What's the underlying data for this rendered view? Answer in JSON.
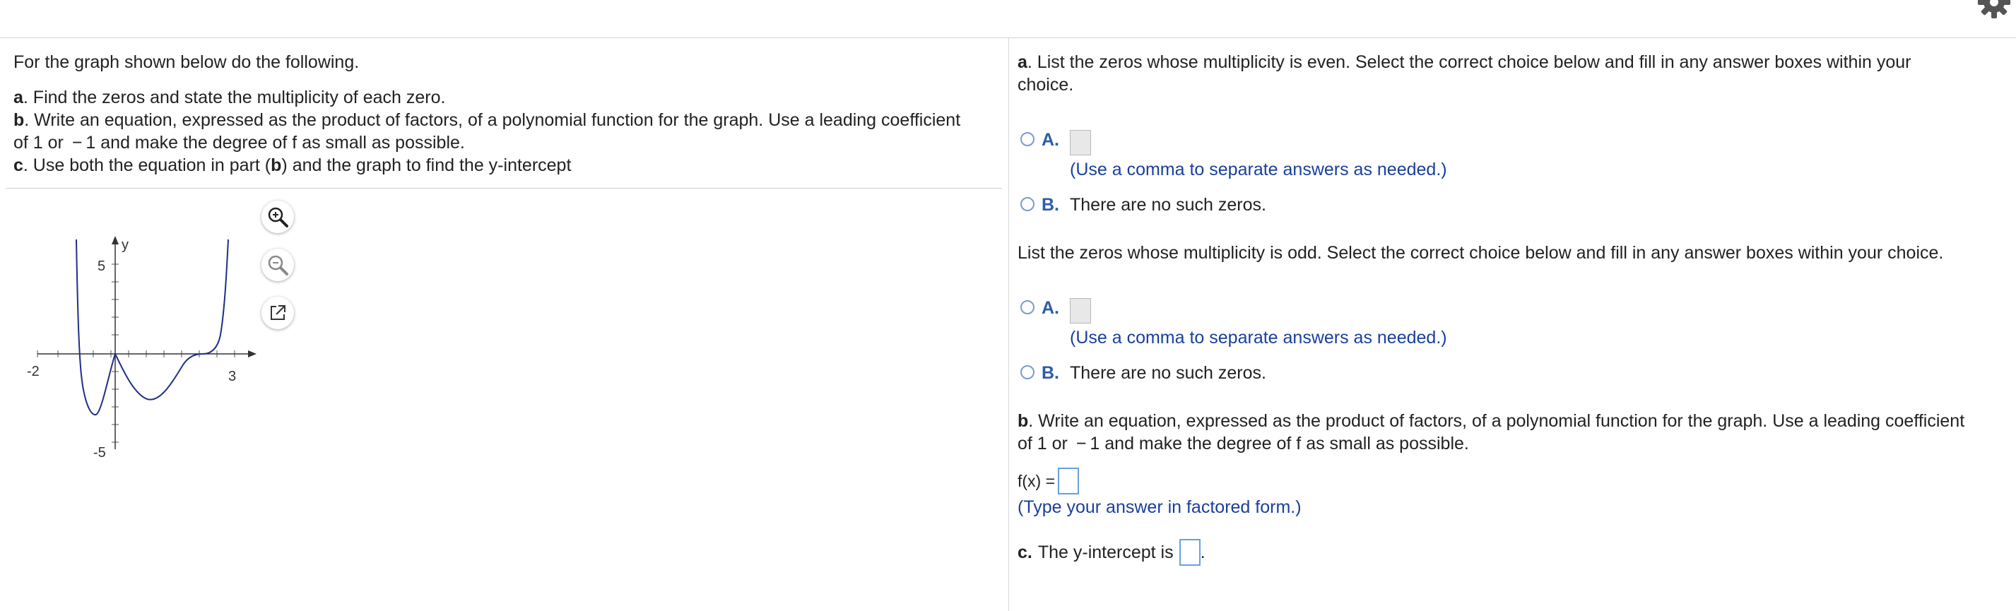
{
  "header": {
    "settings_icon": "gear-icon"
  },
  "left": {
    "intro": "For the graph shown below do the following.",
    "task_a_letter": "a",
    "task_a_text": ". Find the zeros and state the multiplicity of each zero.",
    "task_b_letter": "b",
    "task_b_text_line1": ". Write an equation, expressed as the product of factors, of a polynomial function for the graph. Use a leading coefficient",
    "task_b_text_line2": "of 1 or  − 1 and make the degree of f as small as possible.",
    "task_c_letter": "c",
    "task_c_text_pre": ". Use both the equation in part (",
    "task_c_bold": "b",
    "task_c_text_post": ") and the graph to find the y-intercept"
  },
  "graph": {
    "y_label": "y",
    "tick_x_min": "-2",
    "tick_x_max": "3",
    "tick_y_max": "5",
    "tick_y_min": "-5",
    "tools": [
      "zoom-in-icon",
      "zoom-out-icon",
      "popout-icon"
    ]
  },
  "right": {
    "qa_letter": "a",
    "qa_text_line1": ". List the zeros whose multiplicity is even. Select the correct choice below and fill in any answer boxes within your",
    "qa_text_line2": "choice.",
    "even": {
      "choice_a_letter": "A.",
      "choice_a_hint": "(Use a comma to separate answers as needed.)",
      "choice_b_letter": "B.",
      "choice_b_text": "There are no such zeros."
    },
    "odd_prompt": "List the zeros whose multiplicity is odd. Select the correct choice below and fill in any answer boxes within your choice.",
    "odd": {
      "choice_a_letter": "A.",
      "choice_a_hint": "(Use a comma to separate answers as needed.)",
      "choice_b_letter": "B.",
      "choice_b_text": "There are no such zeros."
    },
    "qb_letter": "b",
    "qb_text_line1": ". Write an equation, expressed as the product of factors, of a polynomial function for the graph. Use a leading coefficient",
    "qb_text_line2": "of 1 or  − 1 and make the degree of f as small as possible.",
    "fx_label": "f(x) =",
    "fx_hint": "(Type your answer in factored form.)",
    "qc_letter": "c.",
    "qc_text": "The y-intercept is",
    "qc_period": "."
  }
}
